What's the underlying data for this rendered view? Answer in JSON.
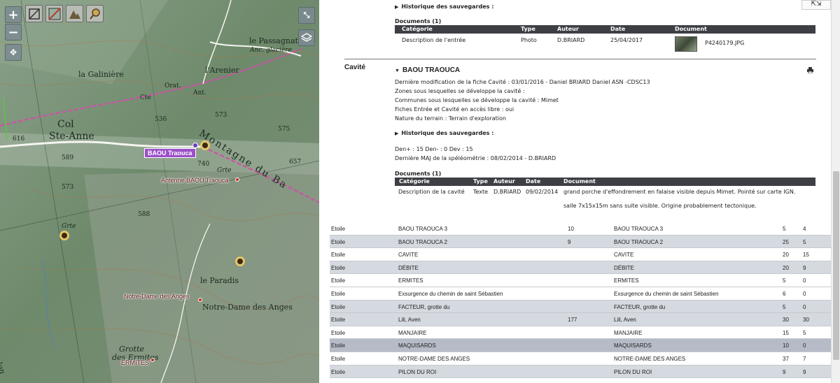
{
  "map": {
    "zoom_in": "+",
    "zoom_out": "−",
    "labels": {
      "le_passagnat": "le Passagnat",
      "anc_glaciere": "Anc. glacière",
      "la_galiniere": "la Galinière",
      "larenier": "l'Arenier",
      "orat": "Orat.",
      "ant": "Ant.",
      "col": "Col",
      "ste_anne": "Ste-Anne",
      "montagne_du_ba": "Montagne  du  Ba",
      "le_paradis": "le Paradis",
      "notre_dame": "Notre-Dame des Anges",
      "grotte_des_ermites_1": "Grotte",
      "grotte_des_ermites_2": "des Ermites",
      "grte1": "Grte",
      "grte2": "Grte",
      "cte": "Cte",
      "alon": "alon",
      "e573": "573",
      "e536": "536",
      "e616": "616",
      "e589": "589",
      "e573b": "573",
      "e740": "740",
      "e588": "588",
      "e575": "575",
      "e657": "657"
    },
    "selected_poi": "BAOU Traouca",
    "pois": [
      {
        "label": "Antenne BAOU Traouca"
      },
      {
        "label": "Notre-Dame des Anges"
      },
      {
        "label": "ERMITES"
      }
    ]
  },
  "panel": {
    "top_hist": "Historique des sauvegardes :",
    "docs1_title": "Documents (1)",
    "docs1_headers": [
      "Catégorie",
      "Type",
      "Auteur",
      "Date",
      "Document"
    ],
    "docs1_row": {
      "categorie": "Description de l'entrée",
      "type": "Photo",
      "auteur": "D.BRIARD",
      "date": "25/04/2017",
      "document": "P4240179.JPG"
    },
    "cavite_heading": "Cavité",
    "cave_name": "BAOU TRAOUCA",
    "info_lines": [
      "Dernière modification de la fiche Cavité : 03/01/2016 - Daniel BRIARD Daniel ASN -CDSC13",
      "Zones sous lesquelles se développe la cavité :",
      "Communes sous lesquelles se développe la cavité : Mimet",
      "Fiches Entrée et Cavité en accès libre : oui",
      "Nature du terrain : Terrain d'exploration"
    ],
    "hist2": "Historique des sauvegardes :",
    "den_line": "Den+ : 15 Den- : 0 Dev : 15",
    "maj_line": "Dernière MAJ de la spéléométrie : 08/02/2014 - D.BRIARD",
    "docs2_title": "Documents (1)",
    "docs2_headers": [
      "Catégorie",
      "Type",
      "Auteur",
      "Date",
      "Document"
    ],
    "docs2_row": {
      "categorie": "Description de la cavité",
      "type": "Texte",
      "auteur": "D.BRIARD",
      "date": "09/02/2014",
      "document_1": "grand porche d'effondrement en falaise visible depuis Mimet. Pointé sur carte IGN.",
      "document_2": "salle 7x15x15m sans suite visible. Origine probablement tectonique."
    }
  },
  "table": {
    "rows": [
      [
        "Etoile",
        "BAOU TRAOUCA 3",
        "10",
        "BAOU TRAOUCA 3",
        "5",
        "4"
      ],
      [
        "Etoile",
        "BAOU TRAOUCA 2",
        "9",
        "BAOU TRAOUCA 2",
        "25",
        "5"
      ],
      [
        "Etoile",
        "CAVITE",
        "",
        "CAVITE",
        "20",
        "15"
      ],
      [
        "Etoile",
        "DÉBITE",
        "",
        "DÉBITE",
        "20",
        "9"
      ],
      [
        "Etoile",
        "ERMITES",
        "",
        "ERMITES",
        "5",
        "0"
      ],
      [
        "Etoile",
        "Exsurgence du chemin de saint Sébastien",
        "",
        "Exsurgence du chemin de saint Sébastien",
        "6",
        "0"
      ],
      [
        "Etoile",
        "FACTEUR, grotte du",
        "",
        "FACTEUR, grotte du",
        "5",
        "0"
      ],
      [
        "Etoile",
        "Lili, Aven",
        "177",
        "Lili, Aven",
        "30",
        "30"
      ],
      [
        "Etoile",
        "MANJAIRE",
        "",
        "MANJAIRE",
        "15",
        "5"
      ],
      [
        "Etoile",
        "MAQUISARDS",
        "",
        "MAQUISARDS",
        "10",
        "0"
      ],
      [
        "Etoile",
        "NOTRE-DAME DES ANGES",
        "",
        "NOTRE-DAME DES ANGES",
        "37",
        "7"
      ],
      [
        "Etoile",
        "PILON DU ROI",
        "",
        "PILON DU ROI",
        "9",
        "9"
      ]
    ]
  }
}
